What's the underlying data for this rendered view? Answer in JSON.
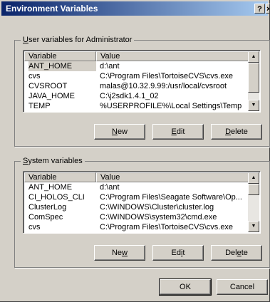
{
  "window": {
    "title": "Environment Variables",
    "help_glyph": "?",
    "close_glyph": "×"
  },
  "user": {
    "legend_access": "U",
    "legend_rest": "ser variables for Administrator",
    "columns": [
      "Variable",
      "Value"
    ],
    "rows": [
      {
        "variable": "ANT_HOME",
        "value": "d:\\ant"
      },
      {
        "variable": "cvs",
        "value": "C:\\Program Files\\TortoiseCVS\\cvs.exe"
      },
      {
        "variable": "CVSROOT",
        "value": "malas@10.32.9.99:/usr/local/cvsroot"
      },
      {
        "variable": "JAVA_HOME",
        "value": "C:\\j2sdk1.4.1_02"
      },
      {
        "variable": "TEMP",
        "value": "%USERPROFILE%\\Local Settings\\Temp"
      }
    ],
    "buttons": {
      "new_access": "N",
      "new_rest": "ew",
      "edit_access": "E",
      "edit_rest": "dit",
      "delete_access": "D",
      "delete_rest": "elete"
    },
    "scroll": {
      "position": 0.0,
      "visible_fraction": 0.8
    }
  },
  "system": {
    "legend_access": "S",
    "legend_rest": "ystem variables",
    "columns": [
      "Variable",
      "Value"
    ],
    "rows": [
      {
        "variable": "ANT_HOME",
        "value": "d:\\ant"
      },
      {
        "variable": "CI_HOLOS_CLI",
        "value": "C:\\Program Files\\Seagate Software\\Op..."
      },
      {
        "variable": "ClusterLog",
        "value": "C:\\WINDOWS\\Cluster\\cluster.log"
      },
      {
        "variable": "ComSpec",
        "value": "C:\\WINDOWS\\system32\\cmd.exe"
      },
      {
        "variable": "cvs",
        "value": "C:\\Program Files\\TortoiseCVS\\cvs.exe"
      }
    ],
    "buttons": {
      "new_pre": "Ne",
      "new_access": "w",
      "edit_pre": "Ed",
      "edit_access": "i",
      "edit_post": "t",
      "delete_pre": "Del",
      "delete_access": "e",
      "delete_post": "te"
    },
    "scroll": {
      "position": 0.0,
      "visible_fraction": 0.3
    }
  },
  "footer": {
    "ok_label": "OK",
    "cancel_label": "Cancel"
  },
  "colors": {
    "dialog_face": "#d4d0c8",
    "title_start": "#0a246a",
    "title_end": "#a6caf0"
  }
}
